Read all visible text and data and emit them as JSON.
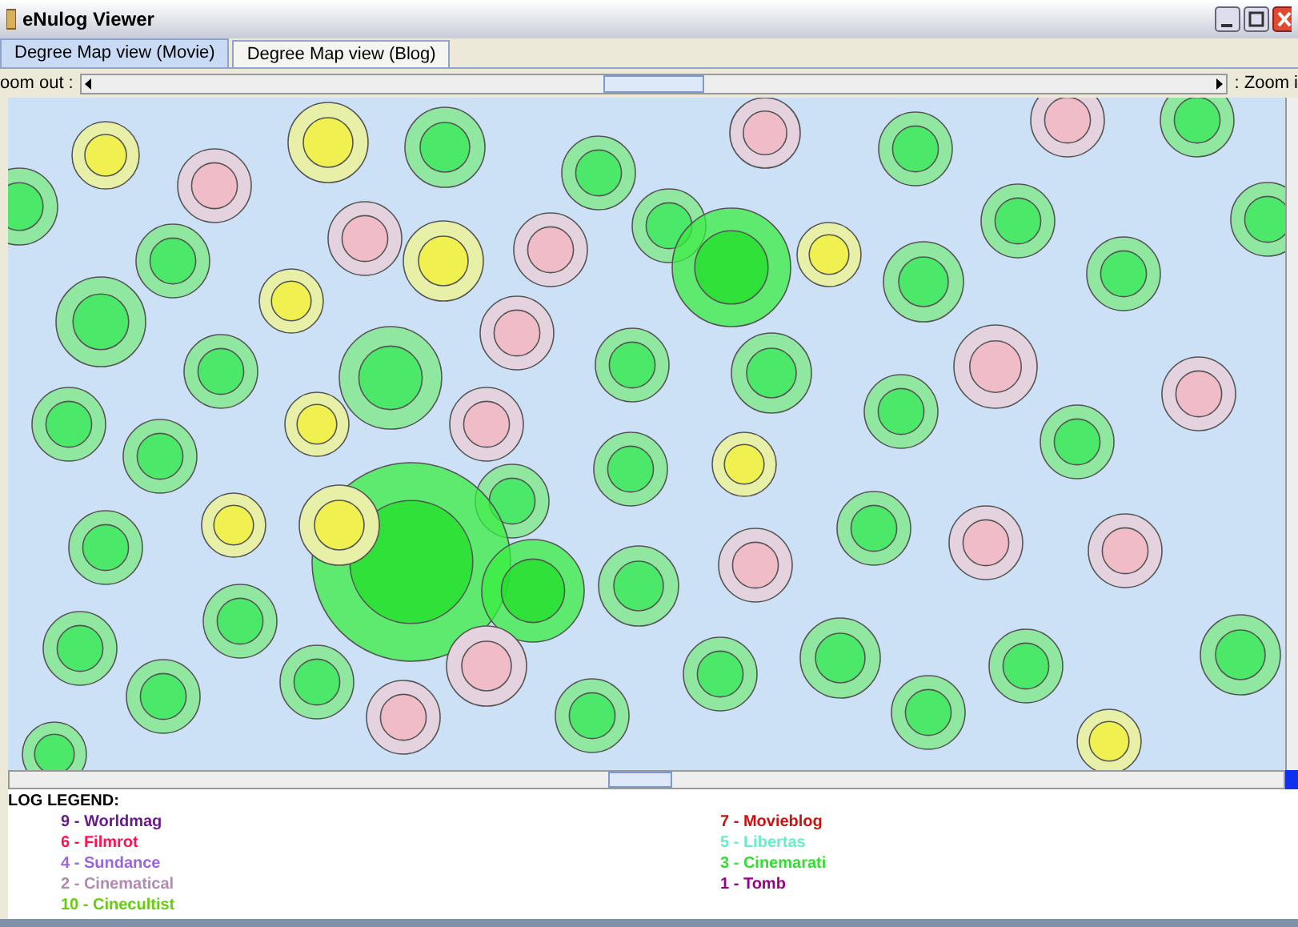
{
  "window": {
    "title": "eNulog Viewer"
  },
  "tabs": [
    {
      "label": "Degree Map view (Movie)",
      "selected": true
    },
    {
      "label": "Degree Map view (Blog)",
      "selected": false
    }
  ],
  "zoom_bar": {
    "left_label": "oom out :",
    "right_label": ": Zoom i",
    "level": 0.5
  },
  "legend": {
    "title": "LOG LEGEND:",
    "columns": [
      [
        {
          "label": "9 - Worldmag",
          "color": "#6a1b8a"
        },
        {
          "label": "6 - Filmrot",
          "color": "#ff1050"
        },
        {
          "label": "4 - Sundance",
          "color": "#9966dd"
        },
        {
          "label": "2 - Cinematical",
          "color": "#b08ab0"
        },
        {
          "label": "10 - Cinecultist",
          "color": "#66cc11"
        }
      ],
      [
        {
          "label": "7 - Movieblog",
          "color": "#cc1111"
        },
        {
          "label": "5 - Libertas",
          "color": "#66eecc"
        },
        {
          "label": "3 - Cinemarati",
          "color": "#33dd33"
        },
        {
          "label": "1 - Tomb",
          "color": "#990088"
        }
      ]
    ]
  }
}
